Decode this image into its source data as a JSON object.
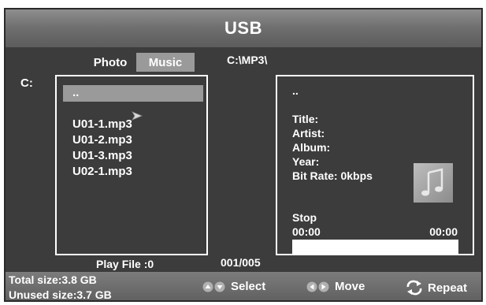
{
  "header": {
    "title": "USB"
  },
  "tabs": [
    {
      "label": "Photo",
      "active": false
    },
    {
      "label": "Music",
      "active": true
    }
  ],
  "drive_label": "C:",
  "current_path": "C:\\MP3\\",
  "file_list": {
    "items": [
      {
        "label": "..",
        "selected": true
      },
      {
        "label": "U01-1.mp3",
        "selected": false
      },
      {
        "label": "U01-2.mp3",
        "selected": false
      },
      {
        "label": "U01-3.mp3",
        "selected": false
      },
      {
        "label": "U02-1.mp3",
        "selected": false
      }
    ],
    "cursor_icon": "arrow-pointer-icon"
  },
  "info_panel": {
    "name": "..",
    "title_label": "Title:",
    "artist_label": "Artist:",
    "album_label": "Album:",
    "year_label": "Year:",
    "bitrate_label": "Bit Rate: 0kbps",
    "thumbnail_icon": "music-note-icon",
    "status": "Stop",
    "time_elapsed": "00:00",
    "time_total": "00:00",
    "progress": 0
  },
  "status_bar": {
    "play_file": "Play File :0",
    "counter": "001/005"
  },
  "footer": {
    "total_size": "Total size:3.8  GB",
    "unused_size": "Unused size:3.7  GB",
    "select_label": "Select",
    "move_label": "Move",
    "repeat_label": "Repeat"
  },
  "colors": {
    "background": "#3c3c3c",
    "highlight": "#9a9a9a",
    "text": "#ffffff"
  }
}
